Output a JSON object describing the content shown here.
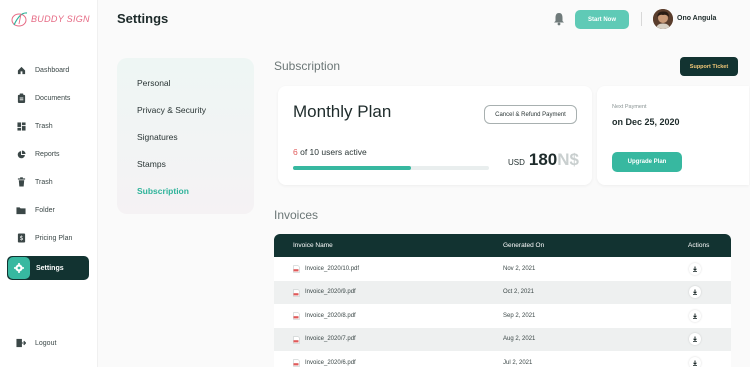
{
  "brand": {
    "name": "BUDDY SIGN"
  },
  "colors": {
    "accent": "#37b8a0",
    "dark": "#123331",
    "highlight": "#e05a5a",
    "support_text": "#f3c878"
  },
  "sidebar": {
    "items": [
      {
        "label": "Dashboard",
        "icon": "home-icon"
      },
      {
        "label": "Documents",
        "icon": "clipboard-icon"
      },
      {
        "label": "Trash",
        "icon": "grid-icon"
      },
      {
        "label": "Reports",
        "icon": "pie-chart-icon"
      },
      {
        "label": "Trash",
        "icon": "trash-icon"
      },
      {
        "label": "Folder",
        "icon": "folder-icon"
      },
      {
        "label": "Pricing Plan",
        "icon": "pricing-icon"
      },
      {
        "label": "Settings",
        "icon": "gear-icon",
        "active": true
      }
    ],
    "logout": {
      "label": "Logout",
      "icon": "logout-icon"
    }
  },
  "header": {
    "title": "Settings",
    "start_now": "Start Now",
    "user_name": "Ono Angula"
  },
  "settings_menu": {
    "items": [
      "Personal",
      "Privacy & Security",
      "Signatures",
      "Stamps",
      "Subscription"
    ],
    "active": "Subscription"
  },
  "subscription": {
    "title": "Subscription",
    "support_ticket": "Support Ticket",
    "plan_name": "Monthly Plan",
    "cancel_refund": "Cancel & Refund Payment",
    "users_used": "6",
    "users_rest": "of 10 users active",
    "usage_fraction": 0.6,
    "currency": "USD",
    "amount": "180",
    "amount_unit": "N$",
    "next_payment_label": "Next Payment",
    "next_payment_date": "on Dec 25, 2020",
    "upgrade": "Upgrade Plan"
  },
  "invoices": {
    "title": "Invoices",
    "columns": [
      "Invoice Name",
      "Generated On",
      "Actions"
    ],
    "rows": [
      {
        "name": "Invoice_2020/10.pdf",
        "date": "Nov 2, 2021"
      },
      {
        "name": "Invoice_2020/9.pdf",
        "date": "Oct 2, 2021"
      },
      {
        "name": "Invoice_2020/8.pdf",
        "date": "Sep 2, 2021"
      },
      {
        "name": "Invoice_2020/7.pdf",
        "date": "Aug 2, 2021"
      },
      {
        "name": "Invoice_2020/6.pdf",
        "date": "Jul 2, 2021"
      }
    ]
  }
}
